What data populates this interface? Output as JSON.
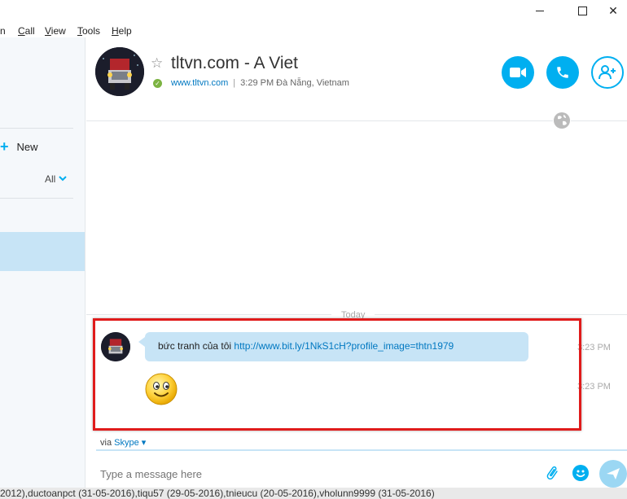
{
  "window": {
    "minimize_icon": "minimize-icon",
    "maximize_icon": "maximize-icon",
    "close_icon": "close-icon",
    "close_glyph": "✕"
  },
  "menu": {
    "items": [
      {
        "label": "n",
        "underline": ""
      },
      {
        "label": "Call",
        "underline": "C"
      },
      {
        "label": "View",
        "underline": "V"
      },
      {
        "label": "Tools",
        "underline": "T"
      },
      {
        "label": "Help",
        "underline": "H"
      }
    ]
  },
  "sidebar": {
    "new_label": "New",
    "plus_glyph": "+",
    "filter_label": "All",
    "filter_chevron": "⌄"
  },
  "header": {
    "contact_name": "tltvn.com - A Viet",
    "star_glyph": "☆",
    "status_glyph": "✓",
    "website": "www.tltvn.com",
    "separator": "|",
    "local_time": "3:29 PM Đà Nẵng, Vietnam",
    "buttons": {
      "video": "video-call-icon",
      "call": "phone-icon",
      "add": "add-contact-icon"
    }
  },
  "chat": {
    "day_label": "Today",
    "messages": [
      {
        "text": "bức tranh của tôi ",
        "link": "http://www.bit.ly/1NkS1cH?profile_image=thtn1979",
        "time": "3:23 PM"
      },
      {
        "emoticon": "smile-emoticon",
        "time": "3:23 PM"
      }
    ]
  },
  "composer": {
    "via_label": "via",
    "service": "Skype",
    "service_chevron": "▾",
    "placeholder": "Type a message here"
  },
  "colors": {
    "accent": "#00aff0",
    "bubble": "#c7e4f6",
    "highlight_box": "#e01b1b",
    "online": "#7cb342"
  },
  "footer_text": "2012),ductoanpct (31-05-2016),tiqu57 (29-05-2016),tnieucu (20-05-2016),vholunn9999 (31-05-2016)"
}
